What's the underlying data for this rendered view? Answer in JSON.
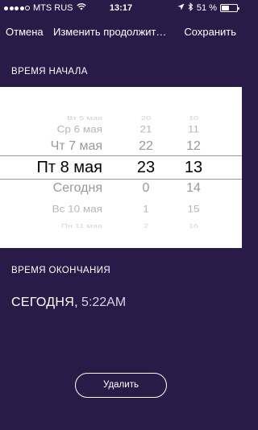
{
  "status_bar": {
    "carrier": "MTS RUS",
    "time": "13:17",
    "battery_percent": "51 %",
    "battery_level": 0.51,
    "signal_bars_filled": 4,
    "signal_bars_total": 5
  },
  "nav": {
    "cancel_label": "Отмена",
    "title": "Изменить продолжительность",
    "save_label": "Сохранить"
  },
  "start_section": {
    "title": "ВРЕМЯ НАЧАЛА"
  },
  "picker": {
    "rows": [
      {
        "date": "Вт 5 мая",
        "hour": "20",
        "minute": "10"
      },
      {
        "date": "Ср 6 мая",
        "hour": "21",
        "minute": "11"
      },
      {
        "date": "Чт 7 мая",
        "hour": "22",
        "minute": "12"
      },
      {
        "date": "Пт 8 мая",
        "hour": "23",
        "minute": "13"
      },
      {
        "date": "Сегодня",
        "hour": "0",
        "minute": "14"
      },
      {
        "date": "Вс 10 мая",
        "hour": "1",
        "minute": "15"
      },
      {
        "date": "Пн 11 мая",
        "hour": "2",
        "minute": "16"
      }
    ],
    "selected_index": 3
  },
  "end_section": {
    "title": "ВРЕМЯ ОКОНЧАНИЯ",
    "day": "СЕГОДНЯ",
    "separator": ",",
    "time": " 5:22AM"
  },
  "delete_label": "Удалить",
  "colors": {
    "background": "#2a1a47",
    "picker_background": "#ffffff",
    "text": "#ffffff"
  }
}
